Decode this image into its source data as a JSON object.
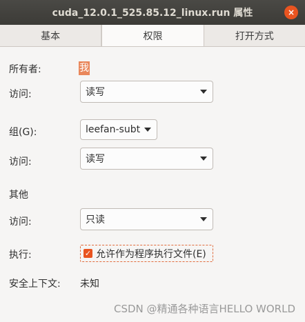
{
  "window": {
    "title": "cuda_12.0.1_525.85.12_linux.run 属性",
    "close_glyph": "×"
  },
  "tabs": [
    {
      "label": "基本",
      "active": false
    },
    {
      "label": "权限",
      "active": true
    },
    {
      "label": "打开方式",
      "active": false
    }
  ],
  "owner": {
    "label": "所有者:",
    "value": "我",
    "access_label": "访问:",
    "access_value": "读写"
  },
  "group": {
    "label": "组(G):",
    "value": "leefan-subt",
    "access_label": "访问:",
    "access_value": "读写"
  },
  "others": {
    "heading": "其他",
    "access_label": "访问:",
    "access_value": "只读"
  },
  "execute": {
    "label": "执行:",
    "checkbox_label": "允许作为程序执行文件(E)",
    "checked": true,
    "check_glyph": "✓"
  },
  "security": {
    "label": "安全上下文:",
    "value": "未知"
  },
  "watermark": "CSDN @精通各种语言HELLO WORLD",
  "colors": {
    "accent": "#e95420",
    "titlebar": "#3c3b37",
    "background": "#f6f5f4"
  },
  "icons": {
    "close": "close-icon",
    "dropdown": "chevron-down-icon",
    "check": "checkmark-icon"
  }
}
